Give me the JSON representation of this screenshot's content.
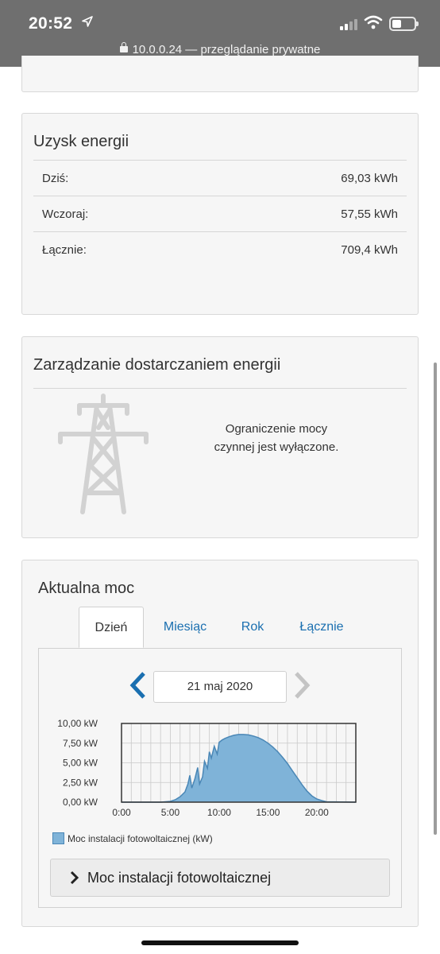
{
  "status_bar": {
    "time": "20:52",
    "url": "10.0.0.24 — przeglądanie prywatne"
  },
  "energy_yield": {
    "title": "Uzysk energii",
    "rows": [
      {
        "label": "Dziś:",
        "value": "69,03 kWh"
      },
      {
        "label": "Wczoraj:",
        "value": "57,55 kWh"
      },
      {
        "label": "Łącznie:",
        "value": "709,4 kWh"
      }
    ]
  },
  "grid_management": {
    "title": "Zarządzanie dostarczaniem energii",
    "message_line1": "Ograniczenie mocy",
    "message_line2": "czynnej jest wyłączone."
  },
  "current_power": {
    "title": "Aktualna moc",
    "tabs": [
      {
        "label": "Dzień",
        "active": true
      },
      {
        "label": "Miesiąc",
        "active": false
      },
      {
        "label": "Rok",
        "active": false
      },
      {
        "label": "Łącznie",
        "active": false
      }
    ],
    "date": "21 maj 2020",
    "legend": "Moc instalacji fotowoltaicznej (kW)",
    "expander_label": "Moc instalacji fotowoltaicznej"
  },
  "colors": {
    "accent": "#1a6fb0",
    "chart_fill": "#7fb3d8",
    "chart_line": "#4a87b6",
    "status_bar": "#6f6f6f"
  },
  "chart_data": {
    "type": "area",
    "ytick_labels": [
      "10,00 kW",
      "7,50 kW",
      "5,00 kW",
      "2,50 kW",
      "0,00 kW"
    ],
    "xtick_labels": [
      "0:00",
      "5:00",
      "10:00",
      "15:00",
      "20:00"
    ],
    "ylim": [
      0,
      10
    ],
    "xlim": [
      0,
      24
    ],
    "grid": true,
    "series": [
      {
        "name": "Moc instalacji fotowoltaicznej (kW)",
        "x": [
          0,
          4,
          5,
          5.5,
          6,
          6.5,
          6.8,
          7,
          7.2,
          7.5,
          7.8,
          8,
          8.3,
          8.5,
          8.8,
          9,
          9.2,
          9.5,
          9.8,
          10,
          10.3,
          10.6,
          11,
          11.5,
          12,
          12.5,
          13,
          13.5,
          14,
          14.5,
          15,
          15.5,
          16,
          16.5,
          17,
          17.5,
          18,
          18.5,
          19,
          19.5,
          20,
          20.5,
          21,
          24
        ],
        "y": [
          0,
          0,
          0.1,
          0.3,
          0.7,
          1.3,
          2.3,
          3.4,
          1.8,
          2.9,
          4.4,
          2.3,
          3.2,
          5.2,
          4.3,
          6.4,
          5.6,
          7.1,
          6.1,
          7.6,
          7.9,
          8.1,
          8.3,
          8.5,
          8.6,
          8.6,
          8.55,
          8.4,
          8.2,
          7.9,
          7.5,
          7.0,
          6.4,
          5.7,
          4.9,
          4.0,
          3.1,
          2.2,
          1.4,
          0.8,
          0.4,
          0.2,
          0.05,
          0
        ]
      }
    ]
  }
}
